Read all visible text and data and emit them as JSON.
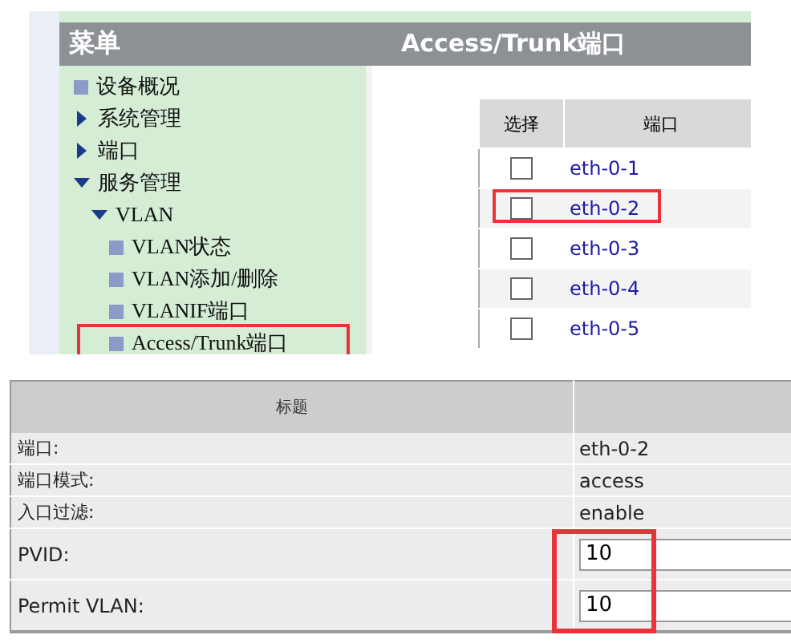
{
  "menu": {
    "title": "菜单",
    "items": [
      {
        "label": "设备概况",
        "kind": "leaf",
        "highlighted": false
      },
      {
        "label": "系统管理",
        "kind": "branch",
        "expanded": false,
        "highlighted": false
      },
      {
        "label": "端口",
        "kind": "branch",
        "expanded": false,
        "highlighted": false
      },
      {
        "label": "服务管理",
        "kind": "branch",
        "expanded": true,
        "highlighted": false,
        "children": [
          {
            "label": "VLAN",
            "kind": "branch",
            "expanded": true,
            "highlighted": false,
            "children": [
              {
                "label": "VLAN状态",
                "kind": "leaf",
                "highlighted": false
              },
              {
                "label": "VLAN添加/删除",
                "kind": "leaf",
                "highlighted": false
              },
              {
                "label": "VLANIF端口",
                "kind": "leaf",
                "highlighted": false
              },
              {
                "label": "Access/Trunk端口",
                "kind": "leaf",
                "highlighted": true
              }
            ]
          }
        ]
      }
    ]
  },
  "page": {
    "title": "Access/Trunk端口"
  },
  "port_table": {
    "columns": [
      "选择",
      "端口"
    ],
    "rows": [
      {
        "port": "eth-0-1",
        "checked": false,
        "highlighted": false
      },
      {
        "port": "eth-0-2",
        "checked": false,
        "highlighted": true
      },
      {
        "port": "eth-0-3",
        "checked": false,
        "highlighted": false
      },
      {
        "port": "eth-0-4",
        "checked": false,
        "highlighted": false
      },
      {
        "port": "eth-0-5",
        "checked": false,
        "highlighted": false
      }
    ]
  },
  "detail_table": {
    "columns": [
      "标题"
    ],
    "fields_highlighted": true,
    "rows": [
      {
        "label": "端口:",
        "kind": "text",
        "value": "eth-0-2"
      },
      {
        "label": "端口模式:",
        "kind": "text",
        "value": "access"
      },
      {
        "label": "入口过滤:",
        "kind": "text",
        "value": "enable"
      },
      {
        "label": "PVID:",
        "kind": "input",
        "value": "10"
      },
      {
        "label": "Permit VLAN:",
        "kind": "input",
        "value": "10"
      }
    ]
  }
}
